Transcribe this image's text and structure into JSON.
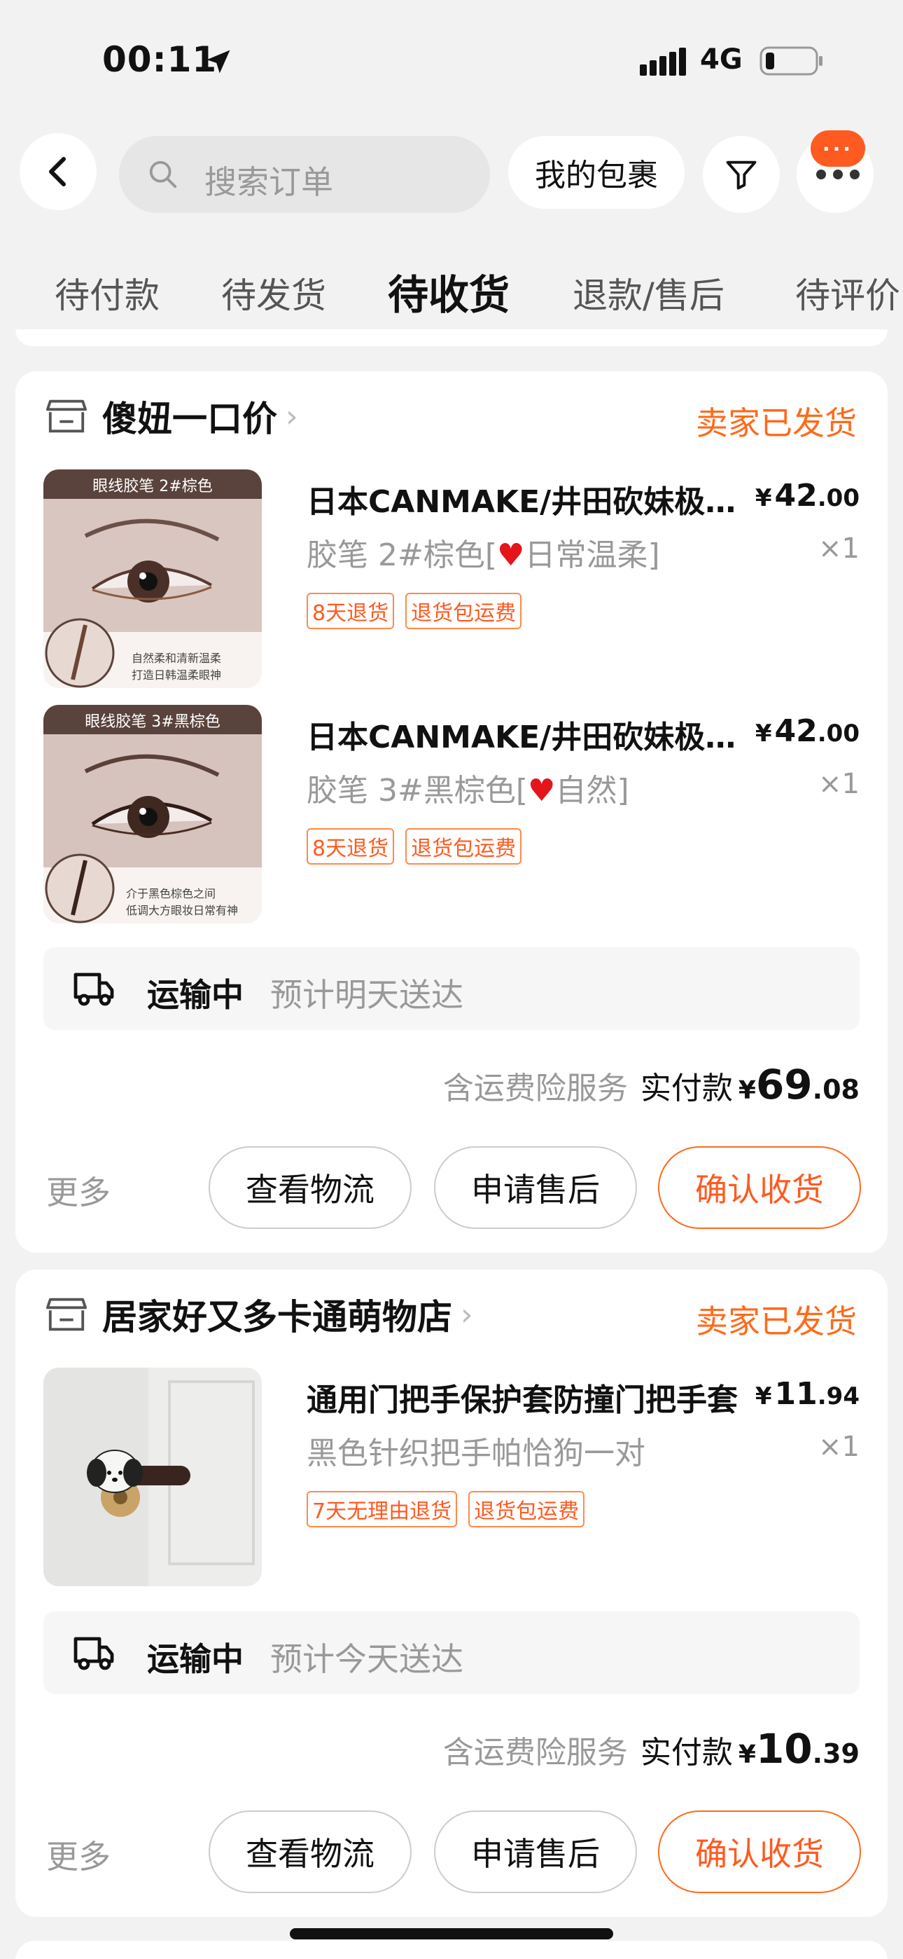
{
  "status_bar": {
    "time": "00:11",
    "network": "4G"
  },
  "header": {
    "search_placeholder": "搜索订单",
    "packages_label": "我的包裹",
    "badge_text": "···"
  },
  "tabs": [
    "待付款",
    "待发货",
    "待收货",
    "退款/售后",
    "待评价"
  ],
  "active_tab": "待收货",
  "orders": [
    {
      "shop": "傻妞一口价",
      "status": "卖家已发货",
      "items": [
        {
          "title": "日本CANMAKE/井田砍妹极细眼线胶笔",
          "price_int": "42",
          "price_dec": ".00",
          "spec_pre": "胶笔 2#棕色[",
          "spec_post": "日常温柔]",
          "qty": "×1",
          "tags": [
            "8天退货",
            "退货包运费"
          ],
          "thumb_caption": "眼线胶笔 2#棕色",
          "thumb_note_1": "自然柔和清新温柔",
          "thumb_note_2": "打造日韩温柔眼神"
        },
        {
          "title": "日本CANMAKE/井田砍妹极细眼线胶笔",
          "price_int": "42",
          "price_dec": ".00",
          "spec_pre": "胶笔 3#黑棕色[",
          "spec_post": "自然]",
          "qty": "×1",
          "tags": [
            "8天退货",
            "退货包运费"
          ],
          "thumb_caption": "眼线胶笔 3#黑棕色",
          "thumb_note_1": "介于黑色棕色之间",
          "thumb_note_2": "低调大方眼妆日常有神"
        }
      ],
      "shipping": {
        "status": "运输中",
        "eta": "预计明天送达"
      },
      "insurance": "含运费险服务",
      "paid_label": "实付款",
      "paid_int": "69",
      "paid_dec": ".08",
      "actions": {
        "more": "更多",
        "logistics": "查看物流",
        "after_sale": "申请售后",
        "confirm": "确认收货"
      }
    },
    {
      "shop": "居家好又多卡通萌物店",
      "status": "卖家已发货",
      "items": [
        {
          "title": "通用门把手保护套防撞门把手套",
          "price_int": "11",
          "price_dec": ".94",
          "spec_pre": "黑色针织把手帕恰狗一对",
          "spec_post": "",
          "qty": "×1",
          "tags": [
            "7天无理由退货",
            "退货包运费"
          ]
        }
      ],
      "shipping": {
        "status": "运输中",
        "eta": "预计今天送达"
      },
      "insurance": "含运费险服务",
      "paid_label": "实付款",
      "paid_int": "10",
      "paid_dec": ".39",
      "actions": {
        "more": "更多",
        "logistics": "查看物流",
        "after_sale": "申请售后",
        "confirm": "确认收货"
      }
    }
  ],
  "currency": "¥",
  "colors": {
    "accent": "#ff6a1a",
    "badge": "#ff5a1f",
    "heart": "#e5151c"
  },
  "icons": [
    "location-arrow-icon",
    "signal-icon",
    "battery-icon",
    "back-arrow-icon",
    "search-icon",
    "filter-icon",
    "more-icon",
    "shop-icon",
    "chevron-right-icon",
    "truck-icon",
    "heart-icon"
  ]
}
